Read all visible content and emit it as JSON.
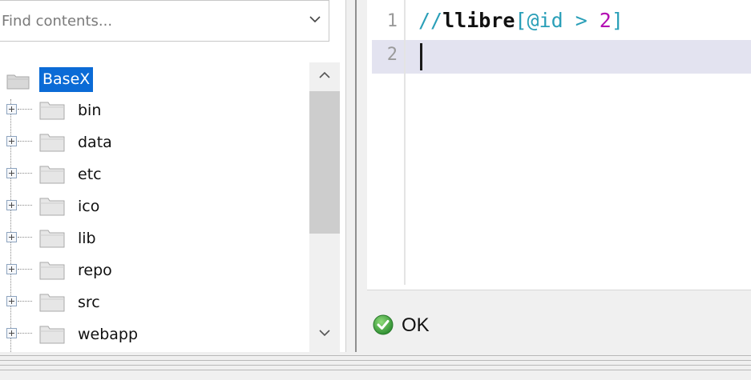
{
  "project_panel": {
    "search": {
      "placeholder": "Find contents...",
      "value": ""
    },
    "tree": {
      "root": {
        "label": "BaseX",
        "selected": true
      },
      "items": [
        {
          "label": "bin"
        },
        {
          "label": "data"
        },
        {
          "label": "etc"
        },
        {
          "label": "ico"
        },
        {
          "label": "lib"
        },
        {
          "label": "repo"
        },
        {
          "label": "src"
        },
        {
          "label": "webapp"
        }
      ]
    }
  },
  "editor": {
    "lines": [
      {
        "number": "1",
        "code": "//llibre[@id > 2]"
      },
      {
        "number": "2",
        "code": ""
      }
    ],
    "tokens": {
      "slash": "//",
      "name": "llibre",
      "open_bracket": "[",
      "attr": "@id",
      "op": " > ",
      "num": "2",
      "close_bracket": "]"
    }
  },
  "status": {
    "text": "OK",
    "icon": "check-circle-icon",
    "color": "#3aa040"
  },
  "colors": {
    "selection": "#0b6bd6",
    "current_line": "#e3e3f0",
    "keyword_teal": "#2a9fb8",
    "number_magenta": "#b30eb3"
  }
}
